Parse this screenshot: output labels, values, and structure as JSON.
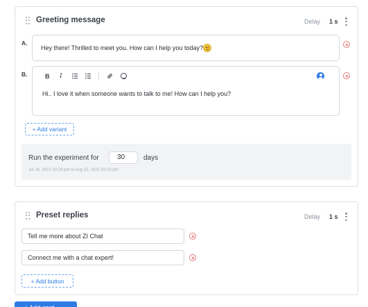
{
  "greeting_card": {
    "title": "Greeting message",
    "delay_label": "Delay",
    "delay_value": "1 s",
    "variants": [
      {
        "letter": "A.",
        "text": "Hey there! Thrilled to meet you. How can I help you today?",
        "emoji": "slightly-smiling-face"
      },
      {
        "letter": "B.",
        "toolbar": {
          "bold": "B",
          "italic": "I"
        },
        "text": "Hi.. I love it when someone wants to talk to me! How can I help you?"
      }
    ],
    "add_variant_label": "+ Add variant",
    "experiment": {
      "label_prefix": "Run the experiment for",
      "days_value": "30",
      "label_suffix": "days",
      "date_range": "Jul 16, 2021 03:19 pm to Aug 15, 2021 03:19 pm"
    }
  },
  "preset_card": {
    "title": "Preset replies",
    "delay_label": "Delay",
    "delay_value": "1 s",
    "replies": [
      "Tell me more about ZI Chat",
      "Connect me with a chat expert!"
    ],
    "add_button_label": "+ Add button"
  },
  "footer": {
    "primary_button_label": "+ Add card"
  },
  "colors": {
    "accent": "#2d7be5",
    "danger": "#e07b7b",
    "panel": "#f2f3f5",
    "border": "#dcdfe4"
  }
}
